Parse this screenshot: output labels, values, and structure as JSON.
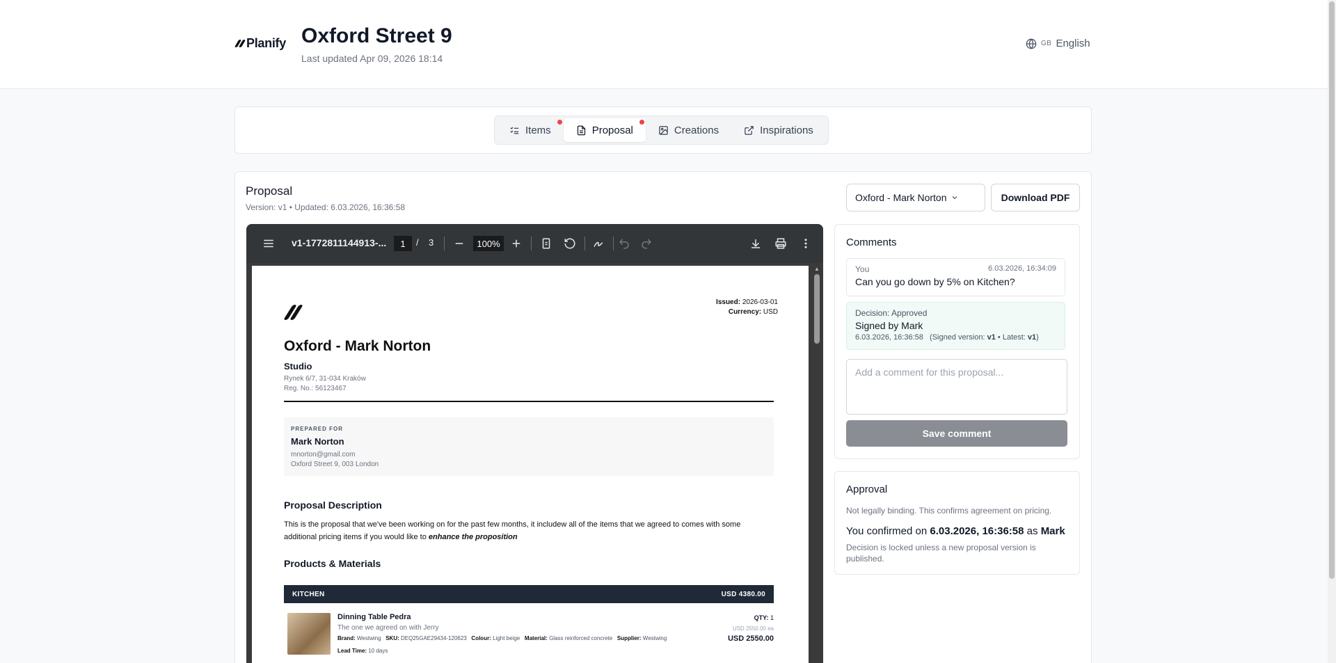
{
  "header": {
    "brand": "Planify",
    "title": "Oxford Street 9",
    "subtitle": "Last updated Apr 09, 2026 18:14",
    "language_code": "GB",
    "language": "English"
  },
  "tabs": [
    {
      "label": "Items",
      "icon": "list-check-icon",
      "has_dot": true,
      "active": false
    },
    {
      "label": "Proposal",
      "icon": "document-icon",
      "has_dot": true,
      "active": true
    },
    {
      "label": "Creations",
      "icon": "image-icon",
      "has_dot": false,
      "active": false
    },
    {
      "label": "Inspirations",
      "icon": "external-link-icon",
      "has_dot": false,
      "active": false
    }
  ],
  "proposal": {
    "title": "Proposal",
    "meta": "Version: v1 • Updated: 6.03.2026, 16:36:58",
    "select_value": "Oxford - Mark Norton",
    "download_label": "Download PDF"
  },
  "viewer": {
    "filename": "v1-1772811144913-...",
    "page_current": "1",
    "page_separator": "/",
    "page_total": "3",
    "zoom": "100%"
  },
  "pdf": {
    "issued_label": "Issued:",
    "issued_value": "2026-03-01",
    "currency_label": "Currency:",
    "currency_value": "USD",
    "client_title": "Oxford - Mark Norton",
    "studio": "Studio",
    "studio_address": "Rynek 6/7, 31-034 Kraków",
    "studio_reg": "Reg. No.: 56123467",
    "prepared_label": "PREPARED FOR",
    "prepared_name": "Mark Norton",
    "prepared_email": "mnorton@gmail.com",
    "prepared_address": "Oxford Street 9, 003 London",
    "desc_heading": "Proposal Description",
    "desc_text": "This is the proposal that we've been working on for the past few months, it includew all of the items that we agreed to comes with some additional pricing items if you would like to ",
    "desc_emphasis": "enhance the proposition",
    "products_heading": "Products & Materials",
    "section_name": "KITCHEN",
    "section_total": "USD 4380.00",
    "item": {
      "name": "Dinning Table Pedra",
      "note": "The one we agreed on with Jerry",
      "brand_label": "Brand:",
      "brand": "Westwing",
      "sku_label": "SKU:",
      "sku": "DEQ25GAE29434-120623",
      "colour_label": "Colour:",
      "colour": "Light beige",
      "material_label": "Material:",
      "material": "Glass reinforced concrete",
      "supplier_label": "Supplier:",
      "supplier": "Westwing",
      "lead_label": "Lead Time:",
      "lead": "10 days",
      "qty_label": "QTY:",
      "qty": "1",
      "unit_price": "USD 2550.00 ea",
      "total": "USD 2550.00"
    }
  },
  "comments": {
    "title": "Comments",
    "items": [
      {
        "author": "You",
        "time": "6.03.2026, 16:34:09",
        "text": "Can you go down by 5% on Kitchen?"
      }
    ],
    "decision": {
      "label": "Decision: Approved",
      "text": "Signed by Mark",
      "time": "6.03.2026, 16:36:58",
      "signed_prefix": "(Signed version:",
      "signed_version": "v1",
      "latest_prefix": "• Latest:",
      "latest_version": "v1",
      "suffix": ")"
    },
    "input_placeholder": "Add a comment for this proposal...",
    "save_label": "Save comment"
  },
  "approval": {
    "title": "Approval",
    "note": "Not legally binding. This confirms agreement on pricing.",
    "confirm_prefix": "You confirmed on",
    "confirm_date": "6.03.2026, 16:36:58",
    "confirm_as": "as",
    "confirm_name": "Mark",
    "lock_text": "Decision is locked unless a new proposal version is published."
  },
  "colors": {
    "accent_dot": "#ef4444",
    "viewer_toolbar": "#323639",
    "save_button": "#8a8d94",
    "decision_bg": "#f1faf6"
  }
}
